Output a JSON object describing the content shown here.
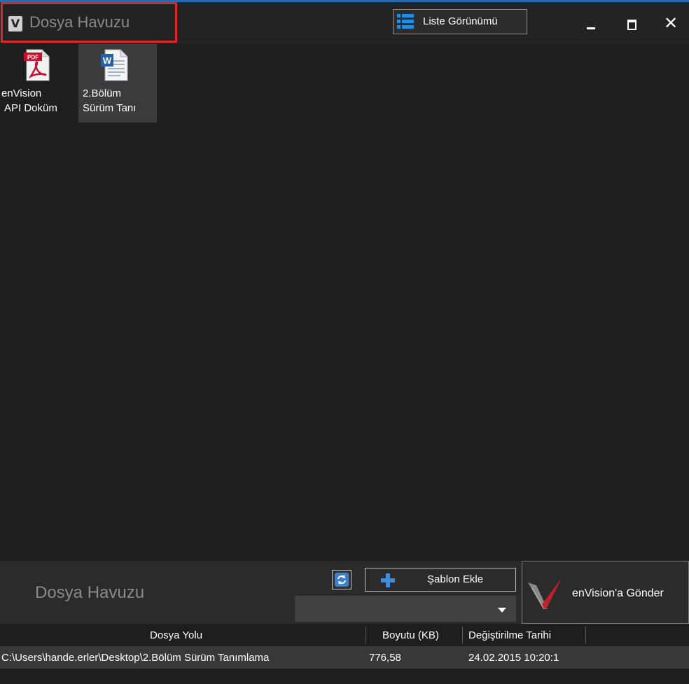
{
  "window": {
    "title": "Dosya Havuzu",
    "logo_letter": "V",
    "view_button_label": "Liste Görünümü",
    "accent_color": "#2b6cb0",
    "highlight_color": "#e2242b"
  },
  "files": [
    {
      "name_line1": "enVision",
      "name_line2": "API Doküm",
      "icon": "pdf-icon",
      "selected": false
    },
    {
      "name_line1": "2.Bölüm",
      "name_line2": "Sürüm Tanı",
      "icon": "word-doc-icon",
      "selected": true
    }
  ],
  "bottom_panel": {
    "title": "Dosya Havuzu",
    "template_button_label": "Şablon Ekle",
    "template_select_value": "",
    "send_button_label": "enVision'a Gönder"
  },
  "table": {
    "headers": [
      "Dosya Yolu",
      "Boyutu (KB)",
      "Değiştirilme Tarihi"
    ],
    "rows": [
      [
        "C:\\Users\\hande.erler\\Desktop\\2.Bölüm Sürüm Tanımlama",
        "776,58",
        "24.02.2015 10:20:1"
      ]
    ]
  }
}
